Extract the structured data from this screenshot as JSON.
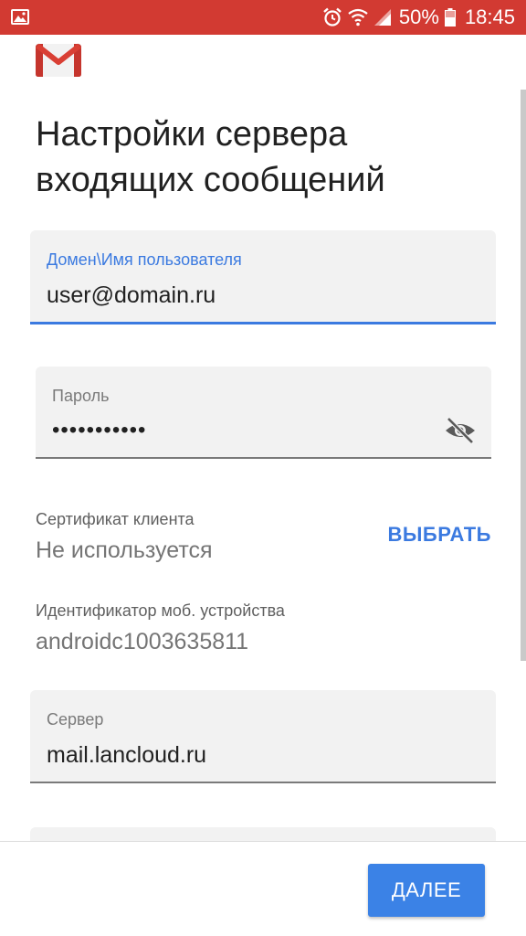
{
  "status_bar": {
    "battery": "50%",
    "time": "18:45",
    "icons": [
      "image-icon",
      "alarm-icon",
      "wifi-icon",
      "signal-icon",
      "battery-icon"
    ],
    "background": "#d23a32"
  },
  "app": {
    "logo": "gmail-logo"
  },
  "page": {
    "title_line1": "Настройки сервера",
    "title_line2": "входящих сообщений"
  },
  "form": {
    "username": {
      "label": "Домен\\Имя пользователя",
      "value": "user@domain.ru",
      "focused": true
    },
    "password": {
      "label": "Пароль",
      "value": "•••••••••••",
      "toggle_icon": "eye-off-icon"
    },
    "client_certificate": {
      "label": "Сертификат клиента",
      "value": "Не используется",
      "action": "ВЫБРАТЬ"
    },
    "device_id": {
      "label": "Идентификатор моб. устройства",
      "value": "androidc1003635811"
    },
    "server": {
      "label": "Сервер",
      "value": "mail.lancloud.ru"
    }
  },
  "footer": {
    "next_label": "ДАЛЕЕ"
  },
  "colors": {
    "accent": "#3b7ae0",
    "button": "#3b82e6",
    "field_bg": "#f2f2f2"
  }
}
